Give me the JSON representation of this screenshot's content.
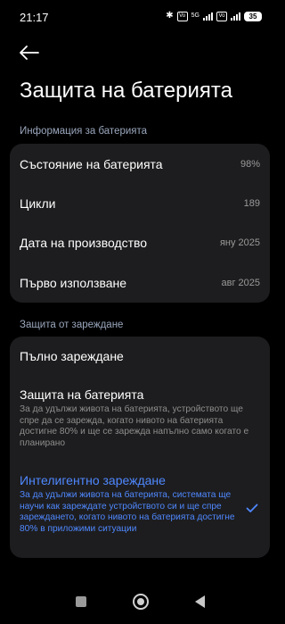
{
  "status_bar": {
    "time": "21:17",
    "battery": "35",
    "sim1": "Vo",
    "sim2": "Vo",
    "network": "5G"
  },
  "header": {
    "title": "Защита на батерията"
  },
  "battery_info": {
    "section_label": "Информация за батерията",
    "rows": [
      {
        "label": "Състояние на батерията",
        "value": "98%"
      },
      {
        "label": "Цикли",
        "value": "189"
      },
      {
        "label": "Дата на производство",
        "value": "яну 2025"
      },
      {
        "label": "Първо използване",
        "value": "авг 2025"
      }
    ]
  },
  "charging_protection": {
    "section_label": "Защита от зареждане",
    "options": [
      {
        "title": "Пълно зареждане",
        "description": ""
      },
      {
        "title": "Защита на батерията",
        "description": "За да удължи живота на батерията, устройството ще спре да се зарежда, когато нивото на батерията достигне 80% и ще се зарежда напълно само когато е планирано"
      },
      {
        "title": "Интелигентно зареждане",
        "description": "За да удължи живота на батерията, системата ще научи как зареждате устройството си и ще спре зареждането, когато нивото на батерията достигне 80% в приложими ситуации",
        "selected": true
      }
    ]
  },
  "colors": {
    "accent": "#4f88ff",
    "card": "#1d1d1f",
    "section_label": "#9aa7bd"
  },
  "icons": {
    "back": "arrow-left-icon",
    "check": "checkmark-icon"
  }
}
